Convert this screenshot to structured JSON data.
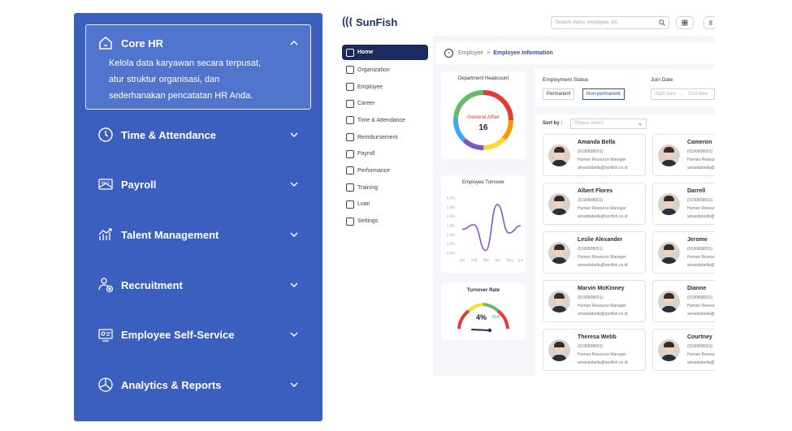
{
  "accordion": {
    "items": [
      {
        "label": "Core HR",
        "icon": "building-icon",
        "expanded": true
      },
      {
        "label": "Time & Attendance",
        "icon": "clock-icon"
      },
      {
        "label": "Payroll",
        "icon": "paid-envelope-icon"
      },
      {
        "label": "Talent Management",
        "icon": "growth-chart-icon"
      },
      {
        "label": "Recruitment",
        "icon": "people-add-icon"
      },
      {
        "label": "Employee Self-Service",
        "icon": "id-card-icon"
      },
      {
        "label": "Analytics & Reports",
        "icon": "pie-chart-icon"
      }
    ],
    "core_hr_desc_lines": [
      "Kelola data karyawan secara terpusat,",
      "atur struktur organisasi, dan",
      "sederhanakan pencatatan HR Anda."
    ]
  },
  "app": {
    "logo": "SunFish",
    "search_placeholder": "Search menu, employee, etc.",
    "nav": [
      "Home",
      "Organization",
      "Employee",
      "Career",
      "Time & Attendance",
      "Reimbursement",
      "Payroll",
      "Performance",
      "Training",
      "Loan",
      "Settings"
    ],
    "breadcrumb": {
      "parent": "Employee",
      "sep": ">",
      "current": "Employee Information"
    },
    "headcount": {
      "title": "Department Headcount",
      "label": "General Affair",
      "value": "16"
    },
    "turnover_chart": {
      "title": "Employee Turnover"
    },
    "turnover_rate": {
      "title": "Turnover Rate",
      "value": "4%",
      "delta": "+0.8"
    },
    "filters": {
      "status_label": "Employment Status",
      "status_options": [
        "Permanent",
        "Non-permanent"
      ],
      "join_label": "Join Date",
      "start_placeholder": "Start date",
      "arrow": "→",
      "end_placeholder": "End date"
    },
    "sort_label": "Sort by :",
    "sort_placeholder": "Please select",
    "employees": [
      {
        "name": "Amanda Bella",
        "id": "(0190808001)",
        "role": "Human Resource Manager",
        "email": "amandabella@sunfish.co.id"
      },
      {
        "name": "Albert Flores",
        "id": "(0190808001)",
        "role": "Human Resource Manager",
        "email": "amandabella@sunfish.co.id"
      },
      {
        "name": "Leslie Alexander",
        "id": "(0190808001)",
        "role": "Human Resource Manager",
        "email": "amandabella@sunfish.co.id"
      },
      {
        "name": "Marvin McKinney",
        "id": "(0190808001)",
        "role": "Human Resource Manager",
        "email": "amandabella@sunfish.co.id"
      },
      {
        "name": "Theresa Webb",
        "id": "(0190808001)",
        "role": "Human Resource Manager",
        "email": "amandabella@sunfish.co.id"
      },
      {
        "name": "Cameron",
        "id": "(0190808001)",
        "role": "Human Resource Manager",
        "email": "amandabella@sunfish.co.id"
      },
      {
        "name": "Darrell",
        "id": "(0190808001)",
        "role": "Human Resource Manager",
        "email": "amandabella@sunfish.co.id"
      },
      {
        "name": "Jerome",
        "id": "(0190808001)",
        "role": "Human Resource Manager",
        "email": "amandabella@sunfish.co.id"
      },
      {
        "name": "Dianne",
        "id": "(0190808001)",
        "role": "Human Resource Manager",
        "email": "amandabella@sunfish.co.id"
      },
      {
        "name": "Courtney",
        "id": "(0190808001)",
        "role": "Human Resource Manager",
        "email": "amandabella@sunfish.co.id"
      }
    ]
  },
  "chart_data": {
    "type": "line",
    "title": "Employee Turnover",
    "categories": [
      "Jan",
      "Feb",
      "Mar",
      "Apr",
      "May",
      "Jun"
    ],
    "y_ticks": [
      "0.0%",
      "1.0%",
      "2.0%",
      "3.0%",
      "4.0%",
      "5.0%",
      "6.0%"
    ],
    "values": [
      2.6,
      3.1,
      0.3,
      5.3,
      2.2,
      3.0
    ],
    "ylim": [
      0,
      6
    ]
  },
  "colors": {
    "accent": "#3b5fbf",
    "nav_active": "#1b2b5e",
    "link": "#2c4ba6"
  }
}
